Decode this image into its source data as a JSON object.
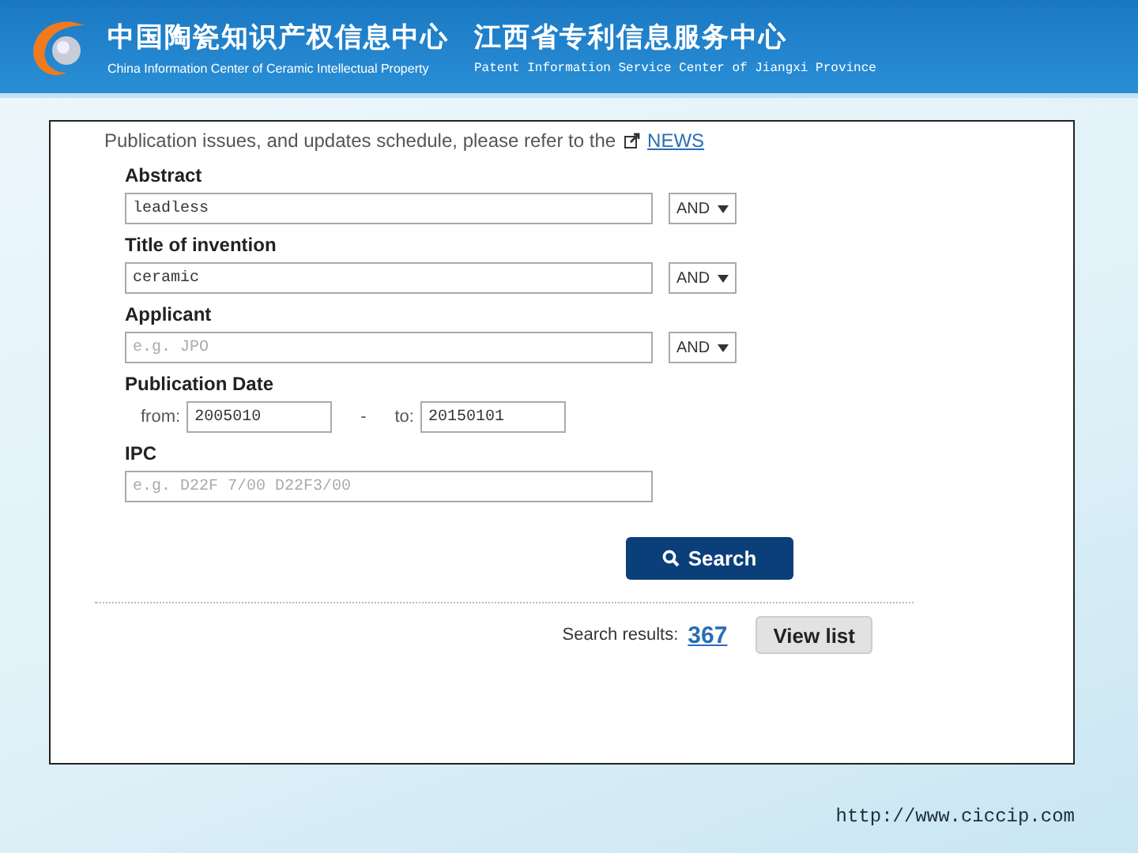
{
  "header": {
    "title_cn": "中国陶瓷知识产权信息中心",
    "subtitle_en": "China Information Center of Ceramic Intellectual Property",
    "title_cn_2": "江西省专利信息服务中心",
    "subtitle_en_2": "Patent Information Service Center of Jiangxi Province"
  },
  "notice": {
    "text": "Publication issues, and updates schedule, please refer to the",
    "link": "NEWS"
  },
  "fields": [
    {
      "kind": "text",
      "label": "Abstract",
      "value": "leadless",
      "operator": "AND"
    },
    {
      "kind": "text",
      "label": "Title of invention",
      "value": "ceramic",
      "operator": "AND"
    },
    {
      "kind": "text",
      "label": "Applicant",
      "placeholder": "e.g. JPO",
      "operator": "AND"
    },
    {
      "kind": "date",
      "label": "Publication Date",
      "from_label": "from:",
      "from": "2005010",
      "separator": "-",
      "to_label": "to:",
      "to": "20150101"
    },
    {
      "kind": "text",
      "label": "IPC",
      "placeholder": "e.g. D22F 7/00 D22F3/00"
    }
  ],
  "search_button": "Search",
  "results": {
    "label": "Search results:",
    "count": "367",
    "button": "View list"
  },
  "footer_url": "http://www.ciccip.com"
}
